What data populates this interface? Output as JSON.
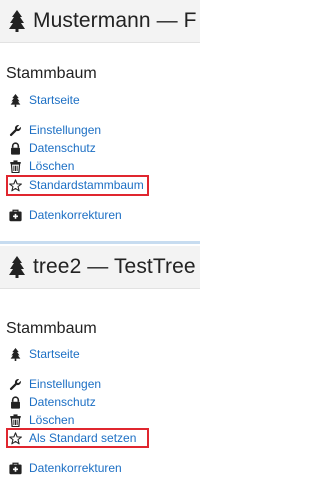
{
  "panels": [
    {
      "header_title": "Mustermann — F",
      "section_title": "Stammbaum",
      "menu": {
        "home": "Startseite",
        "settings": "Einstellungen",
        "privacy": "Datenschutz",
        "delete": "Löschen",
        "default": "Standardstammbaum",
        "corrections": "Datenkorrekturen"
      }
    },
    {
      "header_title": "tree2 — TestTree",
      "section_title": "Stammbaum",
      "menu": {
        "home": "Startseite",
        "settings": "Einstellungen",
        "privacy": "Datenschutz",
        "delete": "Löschen",
        "default": "Als Standard setzen",
        "corrections": "Datenkorrekturen"
      }
    }
  ],
  "icons": {
    "header": "tree-icon",
    "home": "tree-icon",
    "settings": "wrench-icon",
    "privacy": "lock-icon",
    "delete": "trash-icon",
    "default": "star-outline-icon",
    "corrections": "medkit-icon"
  },
  "colors": {
    "link": "#1c6fc4",
    "highlight_border": "#e0262f",
    "header_bg": "#f3f3f3",
    "separator": "#c7dcf0"
  }
}
